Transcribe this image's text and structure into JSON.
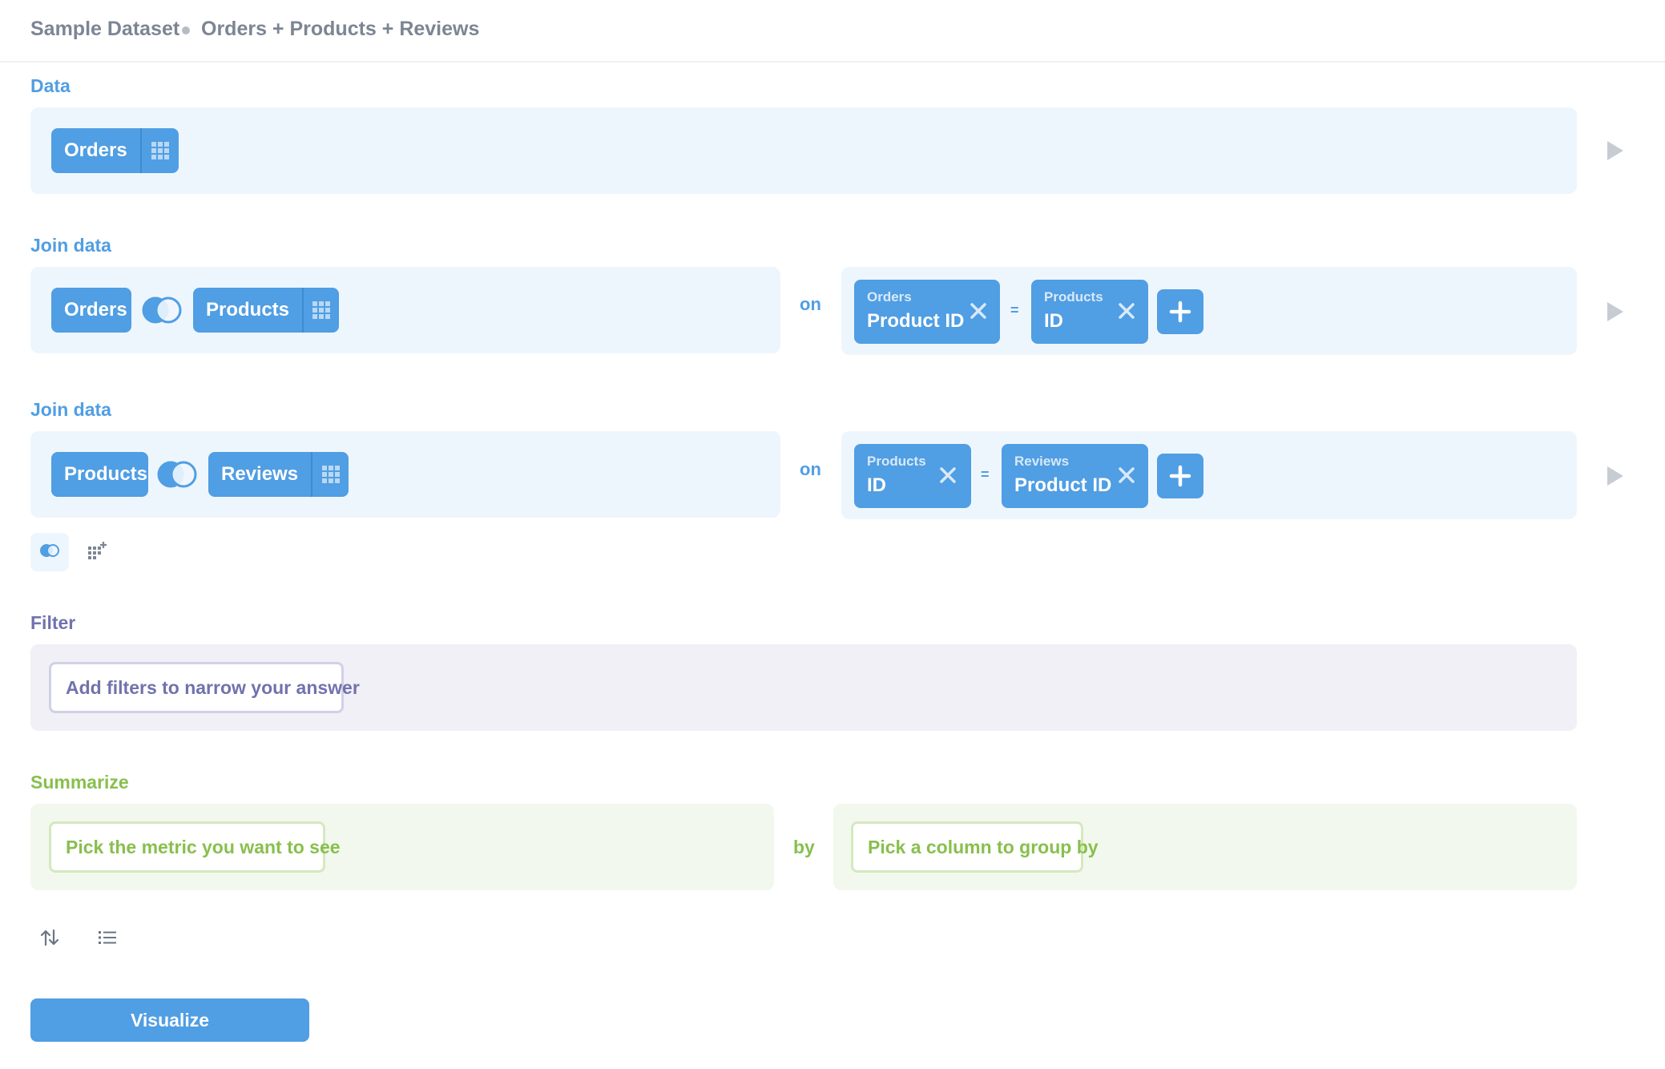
{
  "breadcrumb": {
    "database": "Sample Dataset",
    "question": "Orders + Products + Reviews"
  },
  "data_step": {
    "label": "Data",
    "source_table": "Orders"
  },
  "join1": {
    "label": "Join data",
    "left_table": "Orders",
    "right_table": "Products",
    "on": "on",
    "left_cond": {
      "table": "Orders",
      "field": "Product ID"
    },
    "equals": "=",
    "right_cond": {
      "table": "Products",
      "field": "ID"
    }
  },
  "join2": {
    "label": "Join data",
    "left_table": "Products",
    "right_table": "Reviews",
    "on": "on",
    "left_cond": {
      "table": "Products",
      "field": "ID"
    },
    "equals": "=",
    "right_cond": {
      "table": "Reviews",
      "field": "Product ID"
    }
  },
  "filter": {
    "label": "Filter",
    "placeholder": "Add filters to narrow your answer"
  },
  "summarize": {
    "label": "Summarize",
    "metric_placeholder": "Pick the metric you want to see",
    "by": "by",
    "group_placeholder": "Pick a column to group by"
  },
  "actions": {
    "visualize": "Visualize"
  },
  "icons": {
    "grid": "table-grid-icon",
    "join": "join-venn-icon",
    "close": "close-x-icon",
    "add": "plus-icon",
    "run": "play-icon",
    "sort": "sort-icon",
    "limit": "list-limit-icon",
    "custom_column": "add-column-icon"
  },
  "colors": {
    "brand": "#509ee3",
    "filter": "#7172ad",
    "summarize": "#88bf4d",
    "muted": "#c7ccd3"
  }
}
